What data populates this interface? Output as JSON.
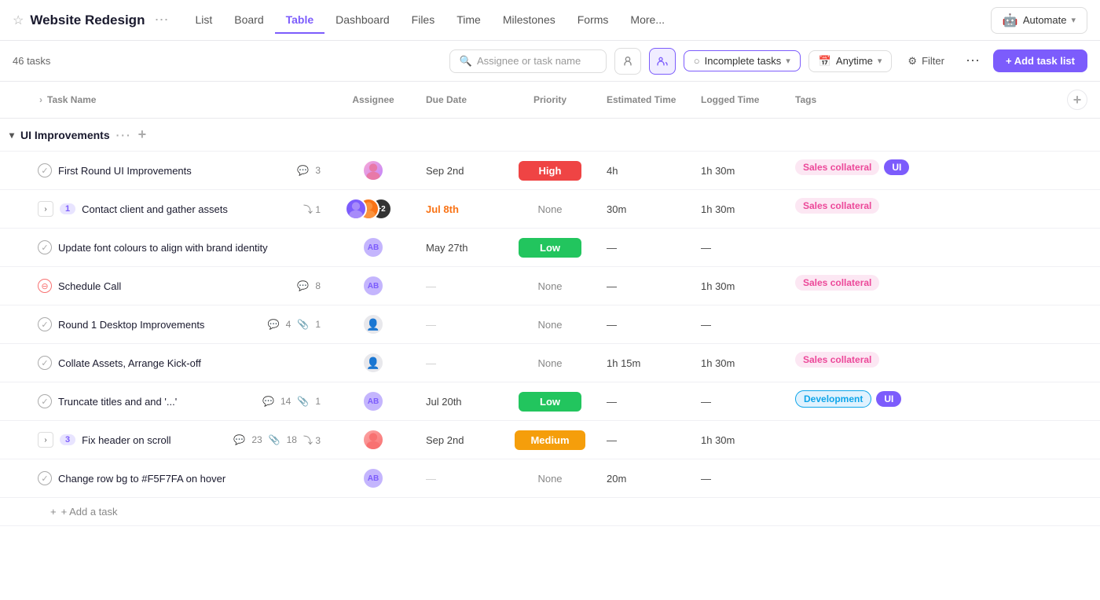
{
  "project": {
    "title": "Website Redesign",
    "task_count": "46 tasks"
  },
  "nav": {
    "tabs": [
      {
        "label": "List",
        "active": false
      },
      {
        "label": "Board",
        "active": false
      },
      {
        "label": "Table",
        "active": true
      },
      {
        "label": "Dashboard",
        "active": false
      },
      {
        "label": "Files",
        "active": false
      },
      {
        "label": "Time",
        "active": false
      },
      {
        "label": "Milestones",
        "active": false
      },
      {
        "label": "Forms",
        "active": false
      },
      {
        "label": "More...",
        "active": false
      }
    ],
    "automate_label": "Automate"
  },
  "toolbar": {
    "search_placeholder": "Assignee or task name",
    "incomplete_tasks_label": "Incomplete tasks",
    "anytime_label": "Anytime",
    "filter_label": "Filter",
    "add_task_list_label": "+ Add task list"
  },
  "table": {
    "columns": [
      "Task Name",
      "Assignee",
      "Due Date",
      "Priority",
      "Estimated Time",
      "Logged Time",
      "Tags"
    ],
    "group": {
      "name": "UI Improvements"
    },
    "tasks": [
      {
        "id": 1,
        "name": "First Round UI Improvements",
        "status": "done",
        "comments": 3,
        "attachments": null,
        "subtasks": null,
        "assignee": {
          "type": "photo",
          "initials": "",
          "color": "#f0a"
        },
        "due_date": "Sep 2nd",
        "due_overdue": false,
        "priority": "High",
        "priority_type": "high",
        "est_time": "4h",
        "logged_time": "1h 30m",
        "tags": [
          {
            "label": "Sales collateral",
            "type": "sales"
          },
          {
            "label": "UI",
            "type": "ui"
          }
        ],
        "expandable": false,
        "sub_count": null,
        "indent": false
      },
      {
        "id": 2,
        "name": "Contact client and gather assets",
        "status": "none",
        "comments": null,
        "attachments": null,
        "subtasks": 1,
        "assignee": {
          "type": "multi",
          "initials": "",
          "color": ""
        },
        "due_date": "Jul 8th",
        "due_overdue": true,
        "priority": "None",
        "priority_type": "none",
        "est_time": "30m",
        "logged_time": "1h 30m",
        "tags": [
          {
            "label": "Sales collateral",
            "type": "sales"
          }
        ],
        "expandable": true,
        "sub_count": 1,
        "indent": false
      },
      {
        "id": 3,
        "name": "Update font colours to align with brand identity",
        "status": "done",
        "comments": null,
        "attachments": null,
        "subtasks": null,
        "assignee": {
          "type": "initials",
          "initials": "AB",
          "color": "#c4b5fd"
        },
        "due_date": "May 27th",
        "due_overdue": false,
        "priority": "Low",
        "priority_type": "low",
        "est_time": "—",
        "logged_time": "—",
        "tags": [],
        "expandable": false,
        "sub_count": null,
        "indent": false
      },
      {
        "id": 4,
        "name": "Schedule Call",
        "status": "blocked",
        "comments": 8,
        "attachments": null,
        "subtasks": null,
        "assignee": {
          "type": "initials",
          "initials": "AB",
          "color": "#c4b5fd"
        },
        "due_date": "—",
        "due_overdue": false,
        "priority": "None",
        "priority_type": "none",
        "est_time": "—",
        "logged_time": "1h 30m",
        "tags": [
          {
            "label": "Sales collateral",
            "type": "sales"
          }
        ],
        "expandable": false,
        "sub_count": null,
        "indent": false
      },
      {
        "id": 5,
        "name": "Round 1 Desktop Improvements",
        "status": "done",
        "comments": 4,
        "attachments": 1,
        "subtasks": null,
        "assignee": {
          "type": "empty",
          "initials": "",
          "color": ""
        },
        "due_date": "—",
        "due_overdue": false,
        "priority": "None",
        "priority_type": "none",
        "est_time": "—",
        "logged_time": "—",
        "tags": [],
        "expandable": false,
        "sub_count": null,
        "indent": false
      },
      {
        "id": 6,
        "name": "Collate Assets, Arrange Kick-off",
        "status": "done",
        "comments": null,
        "attachments": null,
        "subtasks": null,
        "assignee": {
          "type": "empty",
          "initials": "",
          "color": ""
        },
        "due_date": "—",
        "due_overdue": false,
        "priority": "None",
        "priority_type": "none",
        "est_time": "1h 15m",
        "logged_time": "1h 30m",
        "tags": [
          {
            "label": "Sales collateral",
            "type": "sales"
          }
        ],
        "expandable": false,
        "sub_count": null,
        "indent": false
      },
      {
        "id": 7,
        "name": "Truncate titles and and '...'",
        "status": "done",
        "comments": 14,
        "attachments": 1,
        "subtasks": null,
        "assignee": {
          "type": "initials",
          "initials": "AB",
          "color": "#c4b5fd"
        },
        "due_date": "Jul 20th",
        "due_overdue": false,
        "priority": "Low",
        "priority_type": "low",
        "est_time": "—",
        "logged_time": "—",
        "tags": [
          {
            "label": "Development",
            "type": "dev"
          },
          {
            "label": "UI",
            "type": "ui"
          }
        ],
        "expandable": false,
        "sub_count": null,
        "indent": false
      },
      {
        "id": 8,
        "name": "Fix header on scroll",
        "status": "none",
        "comments": 23,
        "attachments": 18,
        "subtasks": 3,
        "assignee": {
          "type": "photo2",
          "initials": "",
          "color": ""
        },
        "due_date": "Sep 2nd",
        "due_overdue": false,
        "priority": "Medium",
        "priority_type": "medium",
        "est_time": "—",
        "logged_time": "1h 30m",
        "tags": [],
        "expandable": true,
        "sub_count": 3,
        "indent": false
      },
      {
        "id": 9,
        "name": "Change row bg to #F5F7FA on hover",
        "status": "done",
        "comments": null,
        "attachments": null,
        "subtasks": null,
        "assignee": {
          "type": "initials",
          "initials": "AB",
          "color": "#c4b5fd"
        },
        "due_date": "—",
        "due_overdue": false,
        "priority": "None",
        "priority_type": "none",
        "est_time": "20m",
        "logged_time": "—",
        "tags": [],
        "expandable": false,
        "sub_count": null,
        "indent": false
      }
    ],
    "add_task_label": "+ Add a task"
  }
}
